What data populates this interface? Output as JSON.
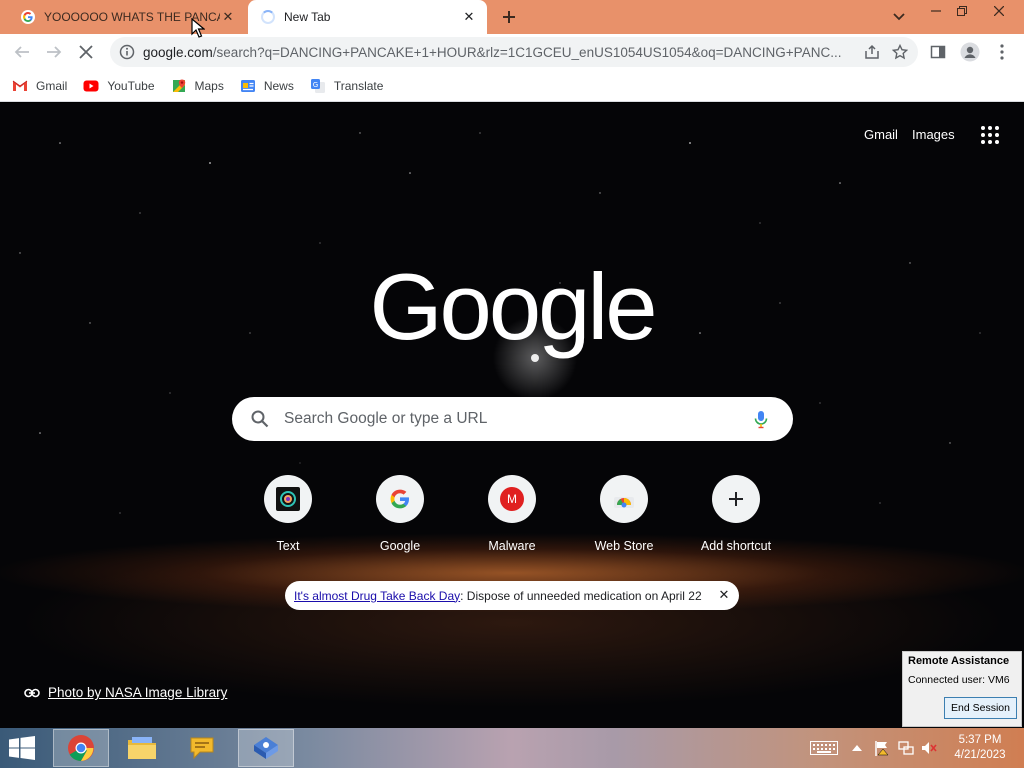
{
  "browser": {
    "tabs": [
      {
        "title": "YOOOOOO WHATS THE PANCA",
        "favicon": "google-g-icon",
        "active": false
      },
      {
        "title": "New Tab",
        "favicon": "loading-spinner-icon",
        "active": true
      }
    ],
    "new_tab_icon": "plus-icon",
    "tab_search_icon": "chevron-down-icon",
    "window_controls": [
      "minimize-icon",
      "restore-icon",
      "close-icon"
    ],
    "omnibox": {
      "domain": "google.com",
      "path": "/search?q=DANCING+PANCAKE+1+HOUR&rlz=1C1GCEU_enUS1054US1054&oq=DANCING+PANC..."
    },
    "bookmarks": [
      {
        "label": "Gmail",
        "icon": "gmail-icon"
      },
      {
        "label": "YouTube",
        "icon": "youtube-icon"
      },
      {
        "label": "Maps",
        "icon": "maps-icon"
      },
      {
        "label": "News",
        "icon": "news-icon"
      },
      {
        "label": "Translate",
        "icon": "translate-icon"
      }
    ]
  },
  "ntp": {
    "header": {
      "gmail": "Gmail",
      "images": "Images"
    },
    "logo": "Google",
    "search_placeholder": "Search Google or type a URL",
    "shortcuts": [
      {
        "label": "Text",
        "icon": "text-site-icon"
      },
      {
        "label": "Google",
        "icon": "google-g-icon"
      },
      {
        "label": "Malware",
        "icon": "malware-m-icon",
        "letter": "M"
      },
      {
        "label": "Web Store",
        "icon": "web-store-icon"
      },
      {
        "label": "Add shortcut",
        "icon": "plus-icon"
      }
    ],
    "promo": {
      "link": "It's almost Drug Take Back Day",
      "text": ": Dispose of unneeded medication on April 22"
    },
    "attribution": "Photo by NASA Image Library"
  },
  "remote_assistance": {
    "title": "Remote Assistance",
    "connected": "Connected user:  VM6",
    "end_session": "End Session"
  },
  "taskbar": {
    "apps": [
      "chrome-icon",
      "file-explorer-icon",
      "chat-bubble-icon",
      "remote-assistance-icon"
    ],
    "time": "5:37 PM",
    "date": "4/21/2023"
  },
  "colors": {
    "tab_strip": "#e8916a",
    "accent_blue": "#1a73e8"
  }
}
